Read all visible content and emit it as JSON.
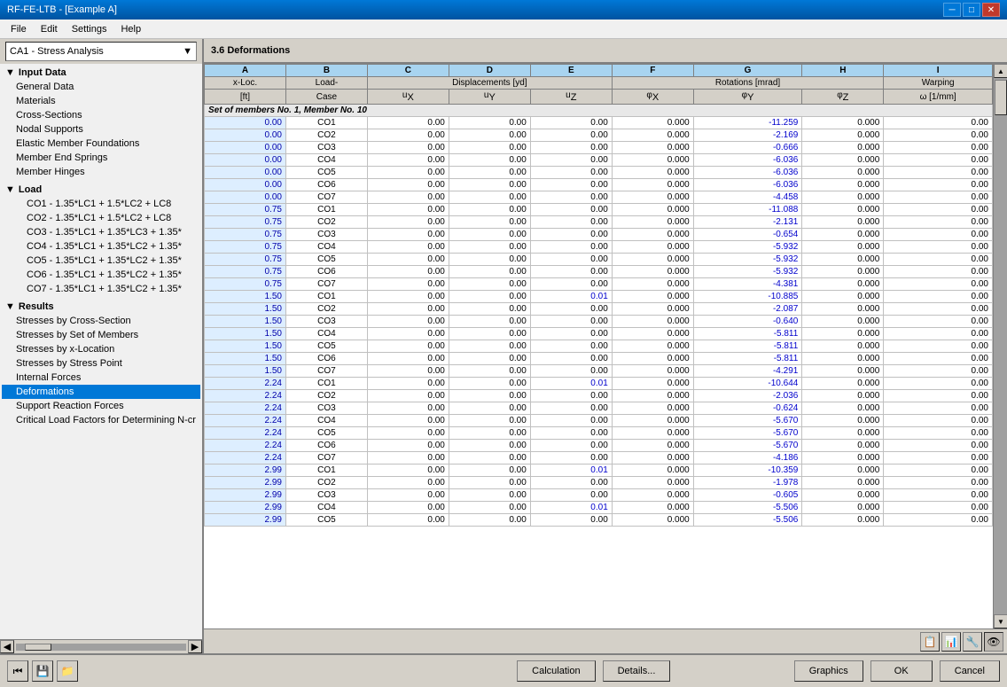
{
  "titlebar": {
    "title": "RF-FE-LTB - [Example A]",
    "close": "✕",
    "minimize": "─",
    "maximize": "□"
  },
  "menu": {
    "items": [
      "File",
      "Edit",
      "Settings",
      "Help"
    ]
  },
  "left_panel": {
    "dropdown_label": "CA1 - Stress Analysis",
    "sections": [
      {
        "label": "Input Data",
        "type": "section",
        "children": [
          {
            "label": "General Data",
            "level": 1
          },
          {
            "label": "Materials",
            "level": 1
          },
          {
            "label": "Cross-Sections",
            "level": 1
          },
          {
            "label": "Nodal Supports",
            "level": 1
          },
          {
            "label": "Elastic Member Foundations",
            "level": 1
          },
          {
            "label": "Member End Springs",
            "level": 1
          },
          {
            "label": "Member Hinges",
            "level": 1
          }
        ]
      },
      {
        "label": "Load",
        "type": "section",
        "children": [
          {
            "label": "CO1 - 1.35*LC1 + 1.5*LC2 + LC8",
            "level": 1
          },
          {
            "label": "CO2 - 1.35*LC1 + 1.5*LC2 + LC8",
            "level": 1
          },
          {
            "label": "CO3 - 1.35*LC1 + 1.35*LC3 + 1.35*",
            "level": 1
          },
          {
            "label": "CO4 - 1.35*LC1 + 1.35*LC2 + 1.35*",
            "level": 1
          },
          {
            "label": "CO5 - 1.35*LC1 + 1.35*LC2 + 1.35*",
            "level": 1
          },
          {
            "label": "CO6 - 1.35*LC1 + 1.35*LC2 + 1.35*",
            "level": 1
          },
          {
            "label": "CO7 - 1.35*LC1 + 1.35*LC2 + 1.35*",
            "level": 1
          }
        ]
      },
      {
        "label": "Results",
        "type": "section",
        "children": [
          {
            "label": "Stresses by Cross-Section",
            "level": 1
          },
          {
            "label": "Stresses by Set of Members",
            "level": 1
          },
          {
            "label": "Stresses by x-Location",
            "level": 1
          },
          {
            "label": "Stresses by Stress Point",
            "level": 1
          },
          {
            "label": "Internal Forces",
            "level": 1
          },
          {
            "label": "Deformations",
            "level": 1,
            "selected": true
          },
          {
            "label": "Support Reaction Forces",
            "level": 1
          },
          {
            "label": "Critical Load Factors for Determining N-cr",
            "level": 1
          }
        ]
      }
    ]
  },
  "right_panel": {
    "header": "3.6 Deformations",
    "table": {
      "col_headers": [
        "A",
        "B",
        "C",
        "D",
        "E",
        "F",
        "G",
        "H",
        "I"
      ],
      "col_labels_row1": [
        "x-Loc.",
        "Load-",
        "Displacements [yd]",
        "",
        "",
        "Rotations [mrad]",
        "",
        "",
        "Warping"
      ],
      "col_labels_row2": [
        "[ft]",
        "Case",
        "uX",
        "uY",
        "uZ",
        "φX",
        "φY",
        "φZ",
        "ω [1/mm]"
      ],
      "set_row": "Set of members No. 1, Member No. 10",
      "rows": [
        [
          0.0,
          "CO1",
          0.0,
          0.0,
          0.0,
          0.0,
          -11.259,
          0.0,
          0.0
        ],
        [
          0.0,
          "CO2",
          0.0,
          0.0,
          0.0,
          0.0,
          -2.169,
          0.0,
          0.0
        ],
        [
          0.0,
          "CO3",
          0.0,
          0.0,
          0.0,
          0.0,
          -0.666,
          0.0,
          0.0
        ],
        [
          0.0,
          "CO4",
          0.0,
          0.0,
          0.0,
          0.0,
          -6.036,
          0.0,
          0.0
        ],
        [
          0.0,
          "CO5",
          0.0,
          0.0,
          0.0,
          0.0,
          -6.036,
          0.0,
          0.0
        ],
        [
          0.0,
          "CO6",
          0.0,
          0.0,
          0.0,
          0.0,
          -6.036,
          0.0,
          0.0
        ],
        [
          0.0,
          "CO7",
          0.0,
          0.0,
          0.0,
          0.0,
          -4.458,
          0.0,
          0.0
        ],
        [
          0.75,
          "CO1",
          0.0,
          0.0,
          0.0,
          0.0,
          -11.088,
          0.0,
          0.0
        ],
        [
          0.75,
          "CO2",
          0.0,
          0.0,
          0.0,
          0.0,
          -2.131,
          0.0,
          0.0
        ],
        [
          0.75,
          "CO3",
          0.0,
          0.0,
          0.0,
          0.0,
          -0.654,
          0.0,
          0.0
        ],
        [
          0.75,
          "CO4",
          0.0,
          0.0,
          0.0,
          0.0,
          -5.932,
          0.0,
          0.0
        ],
        [
          0.75,
          "CO5",
          0.0,
          0.0,
          0.0,
          0.0,
          -5.932,
          0.0,
          0.0
        ],
        [
          0.75,
          "CO6",
          0.0,
          0.0,
          0.0,
          0.0,
          -5.932,
          0.0,
          0.0
        ],
        [
          0.75,
          "CO7",
          0.0,
          0.0,
          0.0,
          0.0,
          -4.381,
          0.0,
          0.0
        ],
        [
          1.5,
          "CO1",
          0.0,
          0.0,
          0.01,
          0.0,
          -10.885,
          0.0,
          0.0
        ],
        [
          1.5,
          "CO2",
          0.0,
          0.0,
          0.0,
          0.0,
          -2.087,
          0.0,
          0.0
        ],
        [
          1.5,
          "CO3",
          0.0,
          0.0,
          0.0,
          0.0,
          -0.64,
          0.0,
          0.0
        ],
        [
          1.5,
          "CO4",
          0.0,
          0.0,
          0.0,
          0.0,
          -5.811,
          0.0,
          0.0
        ],
        [
          1.5,
          "CO5",
          0.0,
          0.0,
          0.0,
          0.0,
          -5.811,
          0.0,
          0.0
        ],
        [
          1.5,
          "CO6",
          0.0,
          0.0,
          0.0,
          0.0,
          -5.811,
          0.0,
          0.0
        ],
        [
          1.5,
          "CO7",
          0.0,
          0.0,
          0.0,
          0.0,
          -4.291,
          0.0,
          0.0
        ],
        [
          2.24,
          "CO1",
          0.0,
          0.0,
          0.01,
          0.0,
          -10.644,
          0.0,
          0.0
        ],
        [
          2.24,
          "CO2",
          0.0,
          0.0,
          0.0,
          0.0,
          -2.036,
          0.0,
          0.0
        ],
        [
          2.24,
          "CO3",
          0.0,
          0.0,
          0.0,
          0.0,
          -0.624,
          0.0,
          0.0
        ],
        [
          2.24,
          "CO4",
          0.0,
          0.0,
          0.0,
          0.0,
          -5.67,
          0.0,
          0.0
        ],
        [
          2.24,
          "CO5",
          0.0,
          0.0,
          0.0,
          0.0,
          -5.67,
          0.0,
          0.0
        ],
        [
          2.24,
          "CO6",
          0.0,
          0.0,
          0.0,
          0.0,
          -5.67,
          0.0,
          0.0
        ],
        [
          2.24,
          "CO7",
          0.0,
          0.0,
          0.0,
          0.0,
          -4.186,
          0.0,
          0.0
        ],
        [
          2.99,
          "CO1",
          0.0,
          0.0,
          0.01,
          0.0,
          -10.359,
          0.0,
          0.0
        ],
        [
          2.99,
          "CO2",
          0.0,
          0.0,
          0.0,
          0.0,
          -1.978,
          0.0,
          0.0
        ],
        [
          2.99,
          "CO3",
          0.0,
          0.0,
          0.0,
          0.0,
          -0.605,
          0.0,
          0.0
        ],
        [
          2.99,
          "CO4",
          0.0,
          0.0,
          0.01,
          0.0,
          -5.506,
          0.0,
          0.0
        ],
        [
          2.99,
          "CO5",
          0.0,
          0.0,
          0.0,
          0.0,
          -5.506,
          0.0,
          0.0
        ]
      ]
    }
  },
  "bottom_icons": [
    "📋",
    "📊",
    "🔧",
    "👁️"
  ],
  "footer": {
    "icon_btns": [
      "⏮",
      "💾",
      "📁"
    ],
    "buttons": [
      "Calculation",
      "Details...",
      "Graphics",
      "OK",
      "Cancel"
    ]
  }
}
